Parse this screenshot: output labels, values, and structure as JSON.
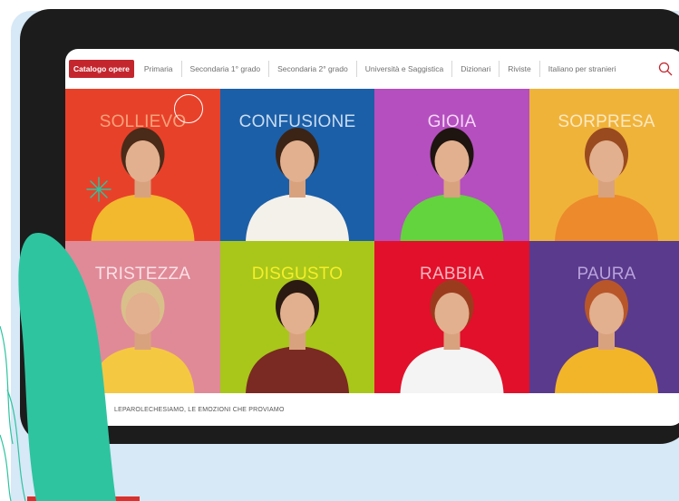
{
  "nav": {
    "catalog_label": "Catalogo opere",
    "items": [
      "Primaria",
      "Secondaria 1° grado",
      "Secondaria 2° grado",
      "Università e Saggistica",
      "Dizionari",
      "Riviste",
      "Italiano per stranieri"
    ]
  },
  "tiles": [
    {
      "label": "SOLLIEVO",
      "bg": "#e8412a",
      "fg": "#f9a27a",
      "shirt": "#f2b82e",
      "hair": "#4a2a18"
    },
    {
      "label": "CONFUSIONE",
      "bg": "#1b5fa8",
      "fg": "#c9dcf2",
      "shirt": "#f4f1ea",
      "hair": "#3b2416"
    },
    {
      "label": "GIOIA",
      "bg": "#b54fbf",
      "fg": "#f4d7f7",
      "shirt": "#63d33e",
      "hair": "#1e1410"
    },
    {
      "label": "SORPRESA",
      "bg": "#f0b33a",
      "fg": "#fde8c0",
      "shirt": "#ec8a2c",
      "hair": "#9a4a1f"
    },
    {
      "label": "TRISTEZZA",
      "bg": "#e08a98",
      "fg": "#fde0e5",
      "shirt": "#f5c842",
      "hair": "#d9c08a"
    },
    {
      "label": "DISGUSTO",
      "bg": "#a8c71a",
      "fg": "#f6ee2a",
      "shirt": "#7a2a22",
      "hair": "#2a1a12"
    },
    {
      "label": "RABBIA",
      "bg": "#e2102a",
      "fg": "#f7b6bf",
      "shirt": "#f4f4f4",
      "hair": "#9b3b1e"
    },
    {
      "label": "PAURA",
      "bg": "#5a3a8c",
      "fg": "#b9a2dc",
      "shirt": "#f2b52a",
      "hair": "#b8562a"
    }
  ],
  "footer": {
    "text": "LEPAROLECHESIAMO, LE EMOZIONI CHE PROVIAMO"
  },
  "colors": {
    "accent": "#c4262e",
    "leaf": "#2ec4a0",
    "panel": "#d7e8f6",
    "tablet": "#1c1c1c"
  },
  "icons": {
    "search": "search-icon",
    "decor_ring": "circle-outline-icon",
    "decor_spark": "sparkle-icon"
  }
}
